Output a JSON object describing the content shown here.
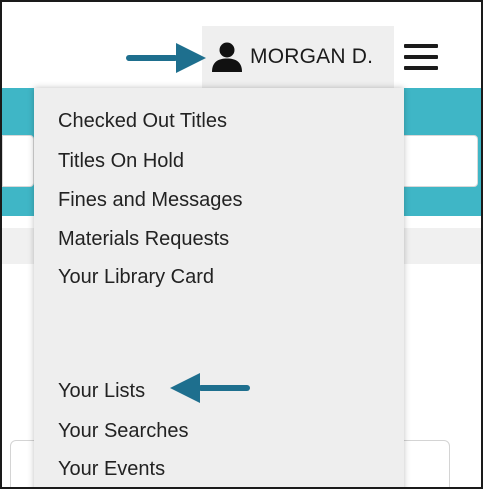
{
  "header": {
    "user_name": "MORGAN D.",
    "user_icon": "user-icon",
    "menu_icon": "hamburger-menu-icon"
  },
  "dropdown": {
    "items": [
      {
        "label": "Checked Out Titles"
      },
      {
        "label": "Titles On Hold"
      },
      {
        "label": "Fines and Messages"
      },
      {
        "label": "Materials Requests"
      },
      {
        "label": "Your Library Card"
      },
      {
        "label": "Your Lists"
      },
      {
        "label": "Your Searches"
      },
      {
        "label": "Your Events"
      }
    ]
  },
  "annotations": {
    "arrow_icon": "arrow-right-icon",
    "arrow_left_icon": "arrow-left-icon"
  },
  "colors": {
    "accent_teal": "#3fb6c6",
    "annotation_arrow": "#1e6f8e",
    "menu_background": "#eeeeee",
    "header_button_background": "#efefef"
  }
}
